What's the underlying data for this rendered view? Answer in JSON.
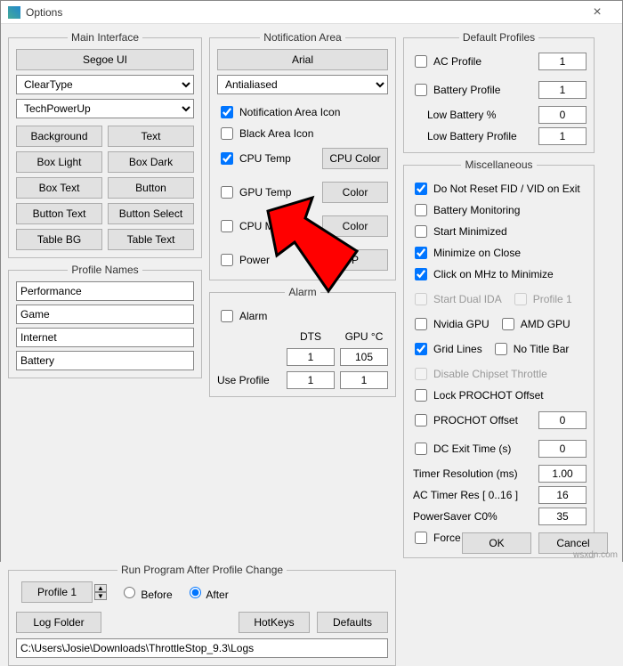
{
  "window": {
    "title": "Options"
  },
  "mainInterface": {
    "legend": "Main Interface",
    "fontBtn": "Segoe UI",
    "renderSelect": "ClearType",
    "brandSelect": "TechPowerUp",
    "buttons": {
      "background": "Background",
      "text": "Text",
      "boxLight": "Box Light",
      "boxDark": "Box Dark",
      "boxText": "Box Text",
      "button": "Button",
      "buttonText": "Button Text",
      "buttonSelect": "Button Select",
      "tableBg": "Table BG",
      "tableText": "Table Text"
    }
  },
  "profileNames": {
    "legend": "Profile Names",
    "p1": "Performance",
    "p2": "Game",
    "p3": "Internet",
    "p4": "Battery"
  },
  "runProgram": {
    "legend": "Run Program After Profile Change",
    "profileSel": "Profile 1",
    "opt1": "Before",
    "opt2": "After",
    "logFolder": "Log Folder",
    "hotkeys": "HotKeys",
    "defaults": "Defaults",
    "path": "C:\\Users\\Josie\\Downloads\\ThrottleStop_9.3\\Logs"
  },
  "notificationArea": {
    "legend": "Notification Area",
    "fontBtn": "Arial",
    "aaSelect": "Antialiased",
    "rows": {
      "icon": "Notification Area Icon",
      "black": "Black Area Icon",
      "cpuTemp": "CPU Temp",
      "cpuColor": "CPU Color",
      "gpuTemp": "GPU Temp",
      "gpuColor": "Color",
      "cpuMhz": "CPU MHz",
      "mhzColor": "Color",
      "power": "Power",
      "powerBtn": "P"
    }
  },
  "alarm": {
    "legend": "Alarm",
    "alarm": "Alarm",
    "dts": "DTS",
    "gpu": "GPU °C",
    "dtsVal": "1",
    "gpuVal": "105",
    "useProfile": "Use Profile",
    "up1": "1",
    "up2": "1"
  },
  "defaultProfiles": {
    "legend": "Default Profiles",
    "ac": "AC Profile",
    "acVal": "1",
    "bat": "Battery Profile",
    "batVal": "1",
    "lowPct": "Low Battery %",
    "lowPctVal": "0",
    "lowProf": "Low Battery Profile",
    "lowProfVal": "1"
  },
  "misc": {
    "legend": "Miscellaneous",
    "noReset": "Do Not Reset FID / VID on Exit",
    "batMon": "Battery Monitoring",
    "startMin": "Start Minimized",
    "minClose": "Minimize on Close",
    "clickMhz": "Click on MHz to Minimize",
    "dualIda": "Start Dual IDA",
    "profile1": "Profile 1",
    "nvidia": "Nvidia GPU",
    "amd": "AMD GPU",
    "grid": "Grid Lines",
    "noTitle": "No Title Bar",
    "chipset": "Disable Chipset Throttle",
    "lockProchot": "Lock PROCHOT Offset",
    "prochot": "PROCHOT Offset",
    "prochotVal": "0",
    "dcExit": "DC Exit Time (s)",
    "dcExitVal": "0",
    "timer": "Timer Resolution (ms)",
    "timerVal": "1.00",
    "acTimer": "AC Timer Res [ 0..16 ]",
    "acTimerVal": "16",
    "psc0": "PowerSaver C0%",
    "psc0Val": "35",
    "tdp": "Force TDP / TDC"
  },
  "footer": {
    "ok": "OK",
    "cancel": "Cancel"
  },
  "watermark": "wsxdn.com"
}
